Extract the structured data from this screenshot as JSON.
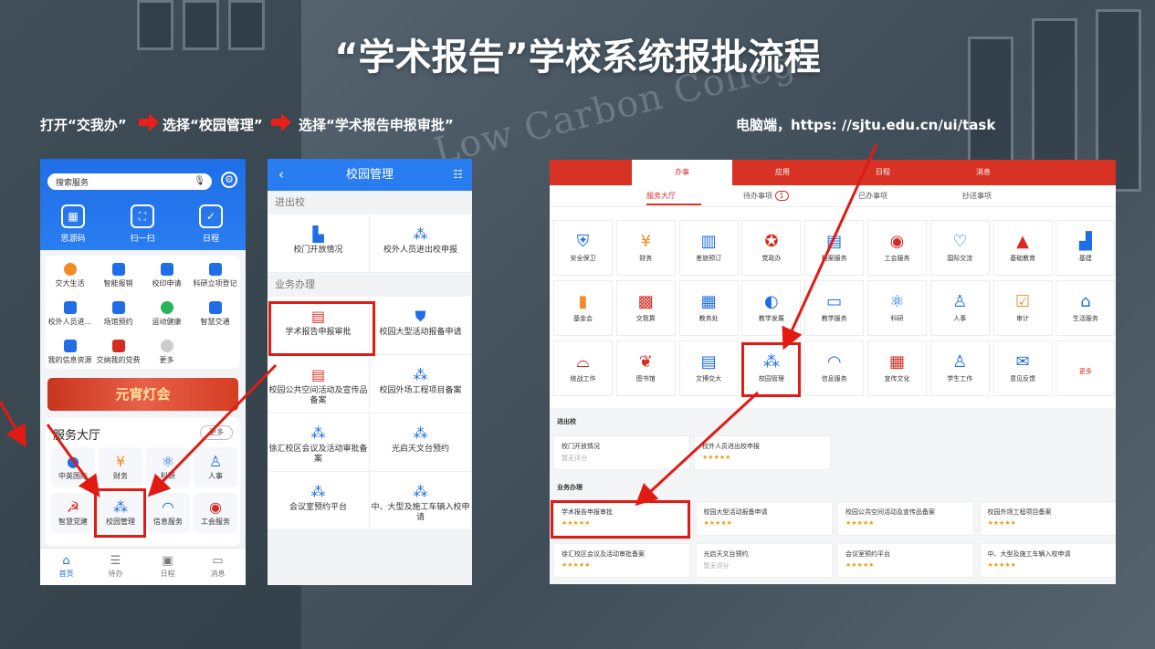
{
  "title": "“学术报告”学校系统报批流程",
  "background_text": "Low Carbon College",
  "steps": {
    "step1": "打开“交我办”",
    "step2": "选择“校园管理”",
    "step3": "选择“学术报告申报审批”",
    "desktop": "电脑端，https: //sjtu.edu.cn/ui/task"
  },
  "phone1": {
    "search_placeholder": "搜索服务",
    "quick": [
      "思源码",
      "扫一扫",
      "日程"
    ],
    "grid": [
      "交大生活",
      "智能报销",
      "校印申请",
      "科研立项登记",
      "校外人员进...",
      "场馆预约",
      "运动健康",
      "智慧交通",
      "我的信息资源",
      "交纳我的党费",
      "更多"
    ],
    "banner": "元宵灯会",
    "services_title": "服务大厅",
    "more": "更多",
    "services": [
      "中英国际",
      "财务",
      "科研",
      "人事",
      "智慧党建",
      "校园管理",
      "信息服务",
      "工会服务"
    ],
    "tabs": [
      "首页",
      "待办",
      "日程",
      "消息"
    ]
  },
  "phone2": {
    "header": "校园管理",
    "sec1": "进出校",
    "r1": [
      "校门开放情况",
      "校外人员进出校申报"
    ],
    "sec2": "业务办理",
    "r2": [
      "学术报告申报审批",
      "校园大型活动报备申请"
    ],
    "r3": [
      "校园公共空间活动及宣传品备案",
      "校园外场工程项目备案"
    ],
    "r4": [
      "徐汇校区会议及活动审批备案",
      "光启天文台预约"
    ],
    "r5": [
      "会议室预约平台",
      "中、大型及施工车辆入校申请"
    ]
  },
  "desktop": {
    "tabs": [
      "办事",
      "应用",
      "日程",
      "消息"
    ],
    "subtabs": [
      "服务大厅",
      "待办事项",
      "已办事项",
      "抄送事项"
    ],
    "pending_count": "1",
    "row1": [
      "安全保卫",
      "财务",
      "差旅预订",
      "党政办",
      "档案服务",
      "工会服务",
      "国际交流",
      "基础教育",
      "基建"
    ],
    "row2": [
      "基金会",
      "交我算",
      "教务处",
      "教学发展",
      "教学服务",
      "科研",
      "人事",
      "审计",
      "生活服务"
    ],
    "row3": [
      "统战工作",
      "图书馆",
      "文博交大",
      "校园管理",
      "信息服务",
      "宣传文化",
      "学生工作",
      "意见反馈",
      "更多"
    ],
    "sec1": "进出校",
    "sec1_cards": [
      "校门开放情况",
      "校外人员进出校申报"
    ],
    "no_rating": "暂无评分",
    "stars": "★★★★★",
    "sec2": "业务办理",
    "sec2_cards": [
      "学术报告申报审批",
      "校园大型活动报备申请",
      "校园公共空间活动及宣传品备案",
      "校园外场工程项目备案",
      "徐汇校区会议及活动审批备案",
      "光启天文台预约",
      "会议室预约平台",
      "中、大型及施工车辆入校申请"
    ]
  },
  "colors": {
    "accent_red": "#e11b14",
    "app_blue": "#2a7df0",
    "desktop_red": "#d73224"
  }
}
